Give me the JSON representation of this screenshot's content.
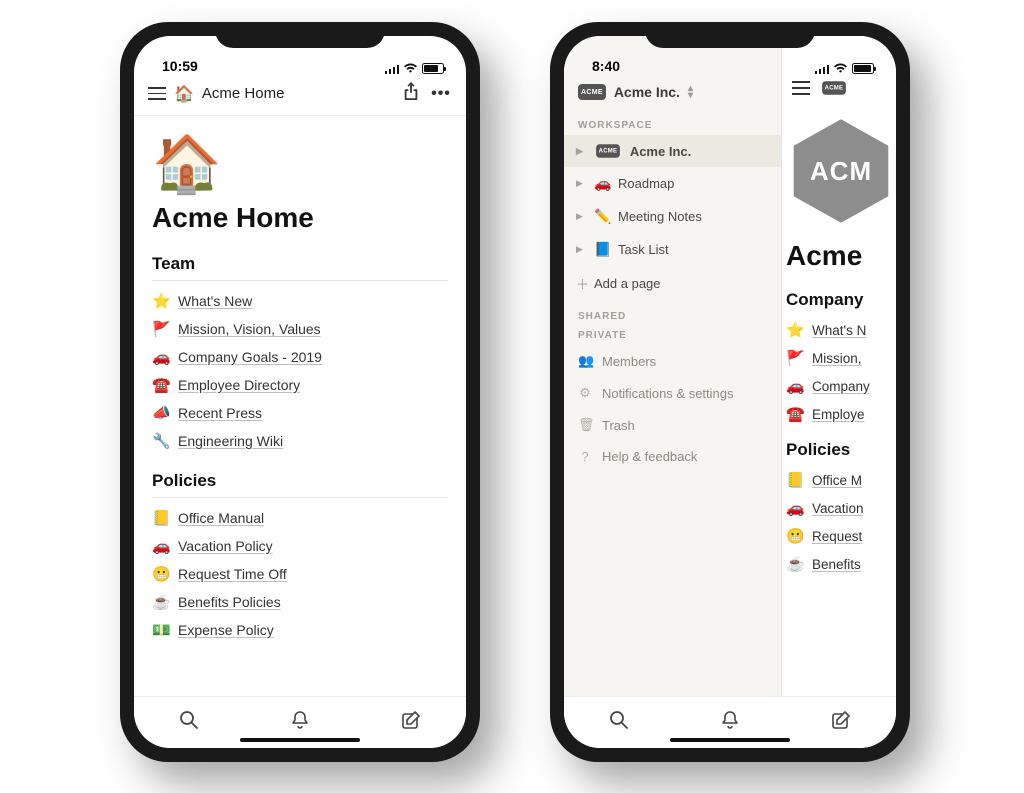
{
  "left": {
    "status_time": "10:59",
    "breadcrumb_emoji": "🏠",
    "breadcrumb_title": "Acme Home",
    "page_emoji": "🏠",
    "page_title": "Acme Home",
    "sections": [
      {
        "heading": "Team",
        "items": [
          {
            "icon": "⭐",
            "label": "What's New"
          },
          {
            "icon": "🚩",
            "label": "Mission, Vision, Values"
          },
          {
            "icon": "🚗",
            "label": "Company Goals - 2019"
          },
          {
            "icon": "☎️",
            "label": "Employee Directory"
          },
          {
            "icon": "📣",
            "label": "Recent Press"
          },
          {
            "icon": "🔧",
            "label": "Engineering Wiki"
          }
        ]
      },
      {
        "heading": "Policies",
        "items": [
          {
            "icon": "📒",
            "label": "Office Manual"
          },
          {
            "icon": "🚗",
            "label": "Vacation Policy"
          },
          {
            "icon": "😬",
            "label": "Request Time Off"
          },
          {
            "icon": "☕",
            "label": "Benefits Policies"
          },
          {
            "icon": "💵",
            "label": "Expense Policy"
          }
        ]
      }
    ]
  },
  "right": {
    "status_time": "8:40",
    "workspace_name": "Acme Inc.",
    "labels": {
      "workspace": "WORKSPACE",
      "shared": "SHARED",
      "private": "PRIVATE",
      "add_page": "Add a page",
      "members": "Members",
      "notifications": "Notifications & settings",
      "trash": "Trash",
      "help": "Help & feedback"
    },
    "pages": [
      {
        "icon_type": "badge",
        "label": "Acme Inc.",
        "selected": true
      },
      {
        "icon": "🚗",
        "label": "Roadmap"
      },
      {
        "icon": "✏️",
        "label": "Meeting Notes"
      },
      {
        "icon": "📘",
        "label": "Task List"
      }
    ],
    "main": {
      "logo_text": "ACM",
      "page_title_partial": "Acme",
      "section1_heading": "Company",
      "section1_items": [
        {
          "icon": "⭐",
          "partial": "What's N"
        },
        {
          "icon": "🚩",
          "partial": "Mission,"
        },
        {
          "icon": "🚗",
          "partial": "Company"
        },
        {
          "icon": "☎️",
          "partial": "Employe"
        }
      ],
      "section2_heading": "Policies",
      "section2_items": [
        {
          "icon": "📒",
          "partial": "Office M"
        },
        {
          "icon": "🚗",
          "partial": "Vacation"
        },
        {
          "icon": "😬",
          "partial": "Request"
        },
        {
          "icon": "☕",
          "partial": "Benefits"
        }
      ]
    }
  }
}
